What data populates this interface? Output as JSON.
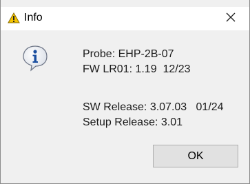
{
  "window": {
    "title": "Info",
    "title_icon": "warning-icon",
    "close_icon": "close-icon"
  },
  "message": {
    "icon": "info-icon",
    "lines": [
      "Probe: EHP-2B-07",
      "FW LR01: 1.19  12/23",
      "SW Release: 3.07.03   01/24",
      "Setup Release: 3.01"
    ]
  },
  "buttons": {
    "ok_label": "OK"
  },
  "colors": {
    "dialog_bg": "#f0f0f0",
    "titlebar_bg": "#ffffff",
    "warning_yellow": "#f5c400",
    "info_blue": "#1b4fa0",
    "button_bg": "#e1e1e1",
    "button_border": "#adadad"
  }
}
